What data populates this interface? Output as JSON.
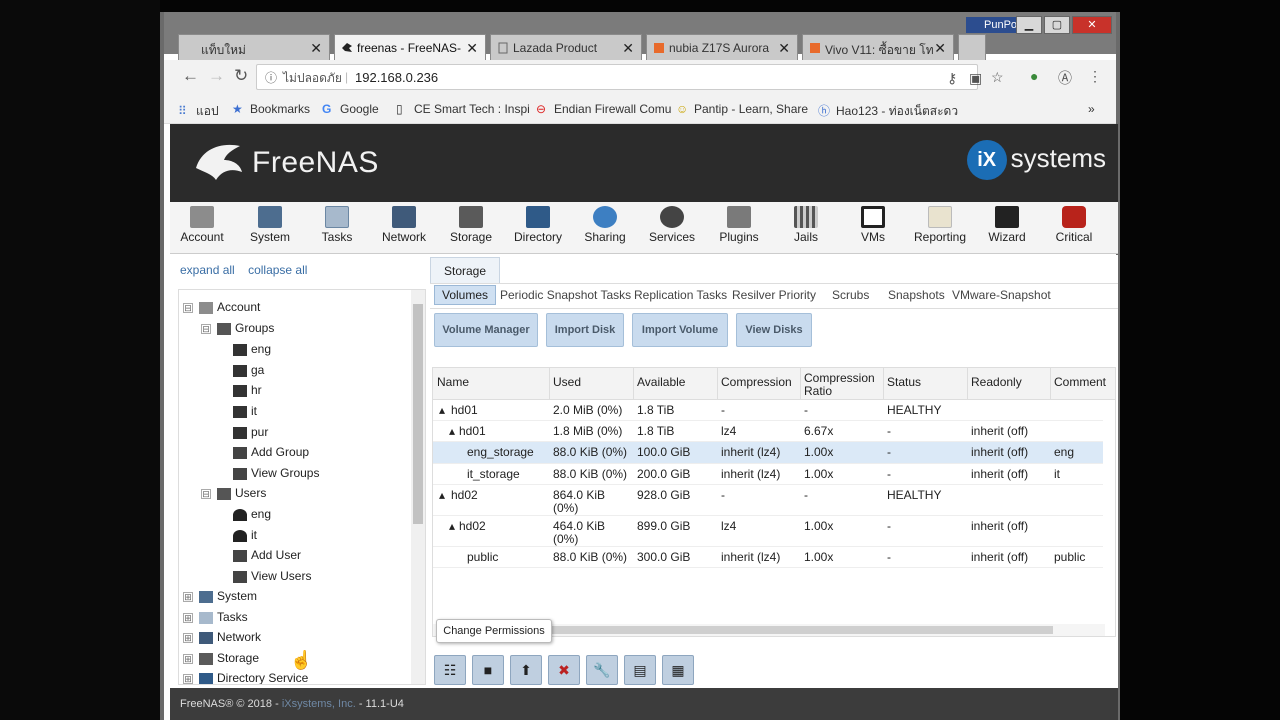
{
  "browser": {
    "tabs": [
      {
        "label": "แท็บใหม่",
        "active": false
      },
      {
        "label": "freenas - FreeNAS-",
        "active": true
      },
      {
        "label": "Lazada Product",
        "active": false
      },
      {
        "label": "nubia Z17S Aurora",
        "active": false
      },
      {
        "label": "Vivo V11: ซื้อขาย โท",
        "active": false
      }
    ],
    "profile_name": "PunPor",
    "security_label": "ไม่ปลอดภัย",
    "url": "192.168.0.236",
    "bookmarks": [
      {
        "label": "แอป"
      },
      {
        "label": "Bookmarks"
      },
      {
        "label": "Google"
      },
      {
        "label": "CE Smart Tech : Inspi"
      },
      {
        "label": "Endian Firewall Comu"
      },
      {
        "label": "Pantip - Learn, Share"
      },
      {
        "label": "Hao123 - ท่องเน็ตสะดว"
      }
    ],
    "more_label": "»"
  },
  "header": {
    "product": "FreeNAS",
    "vendor_logo": "systems",
    "vendor_mark": "iX"
  },
  "nav": [
    {
      "label": "Account",
      "icon": "account-icon"
    },
    {
      "label": "System",
      "icon": "system-icon"
    },
    {
      "label": "Tasks",
      "icon": "tasks-icon"
    },
    {
      "label": "Network",
      "icon": "network-icon"
    },
    {
      "label": "Storage",
      "icon": "storage-icon"
    },
    {
      "label": "Directory",
      "icon": "directory-icon"
    },
    {
      "label": "Sharing",
      "icon": "sharing-icon"
    },
    {
      "label": "Services",
      "icon": "services-icon"
    },
    {
      "label": "Plugins",
      "icon": "plugins-icon"
    },
    {
      "label": "Jails",
      "icon": "jails-icon"
    },
    {
      "label": "VMs",
      "icon": "vms-icon"
    },
    {
      "label": "Reporting",
      "icon": "reporting-icon"
    },
    {
      "label": "Wizard",
      "icon": "wizard-icon"
    },
    {
      "label": "Critical",
      "icon": "critical-icon"
    }
  ],
  "tree": {
    "expand_all": "expand all",
    "collapse_all": "collapse all",
    "items": [
      {
        "label": "Account",
        "toggle": "⊟"
      },
      {
        "label": "Groups",
        "toggle": "⊟"
      },
      {
        "label": "eng"
      },
      {
        "label": "ga"
      },
      {
        "label": "hr"
      },
      {
        "label": "it"
      },
      {
        "label": "pur"
      },
      {
        "label": "Add Group"
      },
      {
        "label": "View Groups"
      },
      {
        "label": "Users",
        "toggle": "⊟"
      },
      {
        "label": "eng"
      },
      {
        "label": "it"
      },
      {
        "label": "Add User"
      },
      {
        "label": "View Users"
      },
      {
        "label": "System",
        "toggle": "⊞"
      },
      {
        "label": "Tasks",
        "toggle": "⊞"
      },
      {
        "label": "Network",
        "toggle": "⊞"
      },
      {
        "label": "Storage",
        "toggle": "⊞"
      },
      {
        "label": "Directory Service",
        "toggle": "⊞"
      }
    ]
  },
  "storage": {
    "tab_label": "Storage",
    "subtabs": [
      "Volumes",
      "Periodic Snapshot Tasks",
      "Replication Tasks",
      "Resilver Priority",
      "Scrubs",
      "Snapshots",
      "VMware-Snapshot"
    ],
    "buttons": [
      "Volume Manager",
      "Import Disk",
      "Import Volume",
      "View Disks"
    ],
    "columns": [
      "Name",
      "Used",
      "Available",
      "Compression",
      "Compression Ratio",
      "Status",
      "Readonly",
      "Comment"
    ],
    "rows": [
      {
        "name": "hd01",
        "toggle": "▴",
        "used": "2.0 MiB (0%)",
        "available": "1.8 TiB",
        "compression": "-",
        "ratio": "-",
        "status": "HEALTHY",
        "readonly": "",
        "comment": ""
      },
      {
        "name": "hd01",
        "toggle": "▴",
        "used": "1.8 MiB (0%)",
        "available": "1.8 TiB",
        "compression": "lz4",
        "ratio": "6.67x",
        "status": "-",
        "readonly": "inherit (off)",
        "comment": ""
      },
      {
        "name": "eng_storage",
        "toggle": "",
        "used": "88.0 KiB (0%)",
        "available": "100.0 GiB",
        "compression": "inherit (lz4)",
        "ratio": "1.00x",
        "status": "-",
        "readonly": "inherit (off)",
        "comment": "eng"
      },
      {
        "name": "it_storage",
        "toggle": "",
        "used": "88.0 KiB (0%)",
        "available": "200.0 GiB",
        "compression": "inherit (lz4)",
        "ratio": "1.00x",
        "status": "-",
        "readonly": "inherit (off)",
        "comment": "it"
      },
      {
        "name": "hd02",
        "toggle": "▴",
        "used": "864.0 KiB (0%)",
        "available": "928.0 GiB",
        "compression": "-",
        "ratio": "-",
        "status": "HEALTHY",
        "readonly": "",
        "comment": ""
      },
      {
        "name": "hd02",
        "toggle": "▴",
        "used": "464.0 KiB (0%)",
        "available": "899.0 GiB",
        "compression": "lz4",
        "ratio": "1.00x",
        "status": "-",
        "readonly": "inherit (off)",
        "comment": ""
      },
      {
        "name": "public",
        "toggle": "",
        "used": "88.0 KiB (0%)",
        "available": "300.0 GiB",
        "compression": "inherit (lz4)",
        "ratio": "1.00x",
        "status": "-",
        "readonly": "inherit (off)",
        "comment": "public"
      }
    ],
    "tooltip": "Change Permissions",
    "bottom_icons": [
      "change-permissions-icon",
      "create-dataset-icon",
      "upload-icon",
      "delete-dataset-icon",
      "settings-wrench-icon",
      "create-zvol-icon",
      "calendar-icon"
    ]
  },
  "footer": {
    "prefix": "FreeNAS® © 2018 - ",
    "company": "iXsystems, Inc.",
    "version": " - 11.1-U4"
  },
  "colors": {
    "accent": "#1b6db5",
    "selected_row": "#dbe9f7",
    "button_bg": "#c9dbee"
  }
}
